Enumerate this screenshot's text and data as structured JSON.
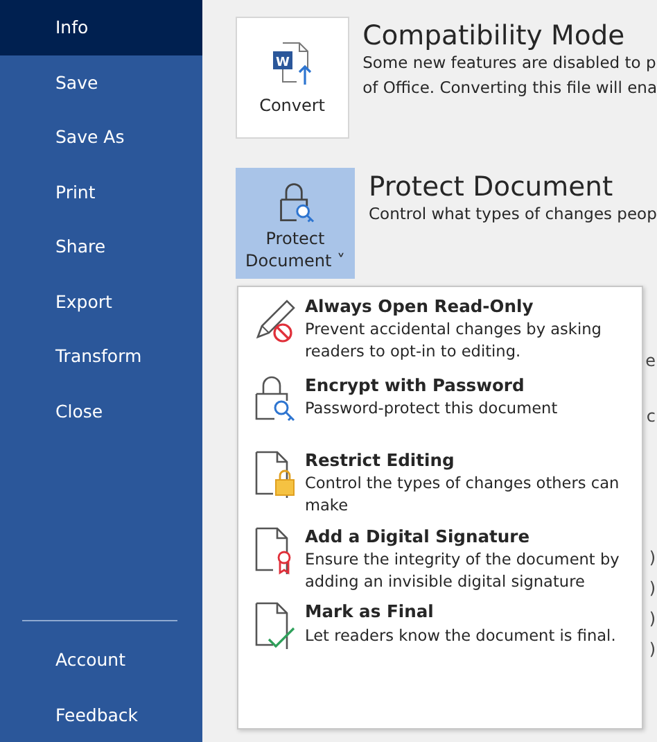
{
  "sidebar": {
    "items": [
      {
        "label": "Info",
        "selected": true
      },
      {
        "label": "Save",
        "selected": false
      },
      {
        "label": "Save As",
        "selected": false
      },
      {
        "label": "Print",
        "selected": false
      },
      {
        "label": "Share",
        "selected": false
      },
      {
        "label": "Export",
        "selected": false
      },
      {
        "label": "Transform",
        "selected": false
      },
      {
        "label": "Close",
        "selected": false
      }
    ],
    "footer_items": [
      {
        "label": "Account",
        "selected": false
      },
      {
        "label": "Feedback",
        "selected": false
      }
    ]
  },
  "sections": [
    {
      "button": {
        "label": "Convert",
        "kind": "convert",
        "expanded": false,
        "icon_text": "W"
      },
      "title": "Compatibility Mode",
      "description": [
        "Some new features are disabled to p",
        "of Office. Converting this file will ena"
      ]
    },
    {
      "button": {
        "label": "Protect Document",
        "kind": "protect",
        "expanded": true,
        "caret": "˅"
      },
      "title": "Protect Document",
      "description": [
        "Control what types of changes peop"
      ]
    }
  ],
  "background_fragments": [
    "e",
    "c",
    ")",
    ")",
    ")",
    ")"
  ],
  "menu": {
    "items": [
      {
        "kind": "read-only",
        "title": "Always Open Read-Only",
        "description": "Prevent accidental changes by asking readers to opt-in to editing."
      },
      {
        "kind": "password",
        "title": "Encrypt with Password",
        "description": "Password-protect this document"
      },
      {
        "kind": "restrict",
        "title": "Restrict Editing",
        "description": "Control the types of changes others can make"
      },
      {
        "kind": "signature",
        "title": "Add a Digital Signature",
        "description": "Ensure the integrity of the document by adding an invisible digital signature"
      },
      {
        "kind": "final",
        "title": "Mark as Final",
        "description": "Let readers know the document is final."
      }
    ]
  }
}
